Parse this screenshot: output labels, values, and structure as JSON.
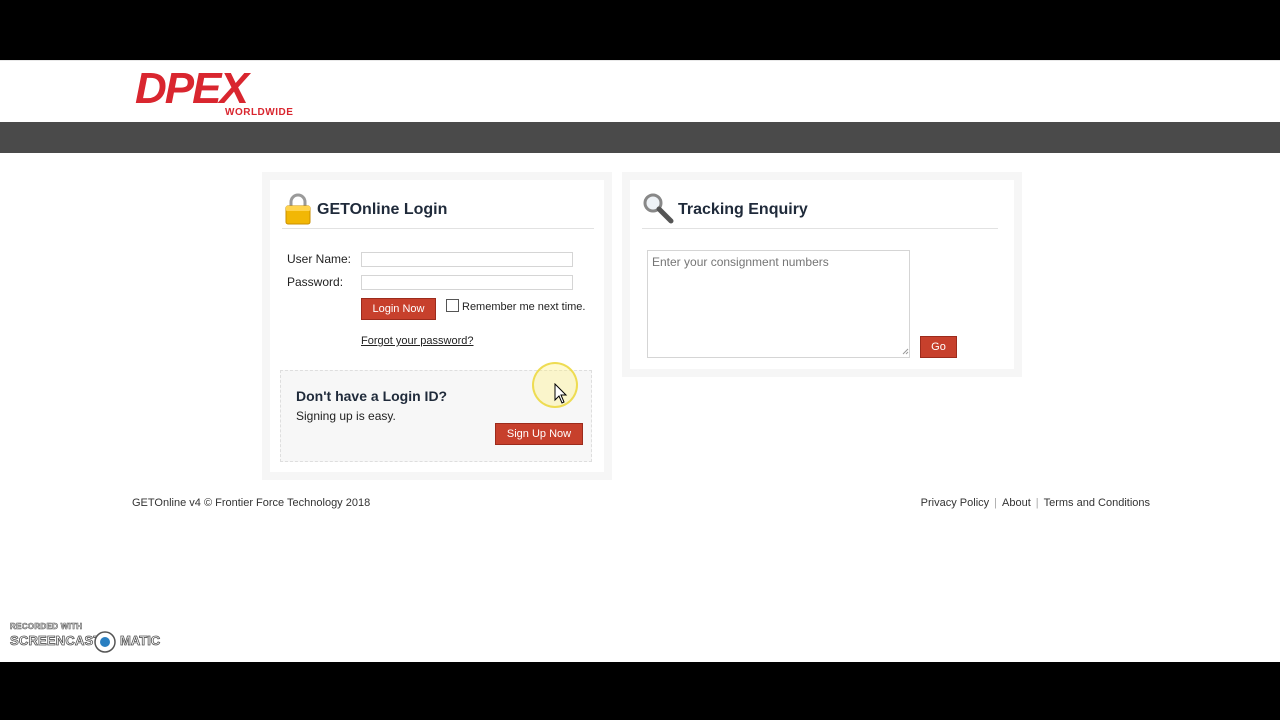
{
  "brand": {
    "logo_text": "DPEX",
    "logo_subtext": "WORLDWIDE",
    "primary_color": "#c7402c"
  },
  "login": {
    "title": "GETOnline Login",
    "icon": "lock-icon",
    "username_label": "User Name:",
    "username_value": "",
    "password_label": "Password:",
    "password_value": "",
    "login_button": "Login Now",
    "remember_label": "Remember me next time.",
    "remember_checked": false,
    "forgot_link": "Forgot your password?",
    "signup_title": "Don't have a Login ID?",
    "signup_subtitle": "Signing up is easy.",
    "signup_button": "Sign Up Now"
  },
  "tracking": {
    "title": "Tracking Enquiry",
    "icon": "magnifier-icon",
    "placeholder": "Enter your consignment numbers",
    "go_button": "Go"
  },
  "footer": {
    "copyright": "GETOnline v4 © Frontier Force Technology 2018",
    "links": [
      "Privacy Policy",
      "About",
      "Terms and Conditions"
    ]
  },
  "watermark": {
    "line1": "RECORDED WITH",
    "line2a": "SCREENCAST",
    "line2b": "MATIC"
  }
}
